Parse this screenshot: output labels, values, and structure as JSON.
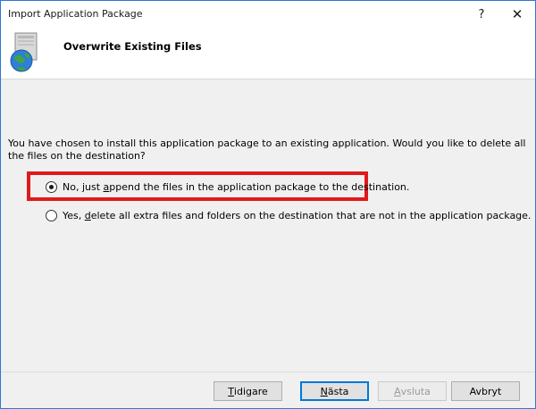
{
  "window": {
    "title": "Import Application Package",
    "help_glyph": "?",
    "close_glyph": "✕"
  },
  "header": {
    "title": "Overwrite Existing Files",
    "icon": "globe-package-icon"
  },
  "content": {
    "question": "You have chosen to install this application package to an existing application. Would you like to delete all the files on the destination?",
    "options": [
      {
        "pre": "No, just ",
        "accel": "a",
        "post": "ppend the files in the application package to the destination.",
        "checked": true
      },
      {
        "pre": "Yes, ",
        "accel": "d",
        "post": "elete all extra files and folders on the destination that are not in the application package.",
        "checked": false
      }
    ],
    "highlight_color": "#e01919"
  },
  "buttons": {
    "back": {
      "accel": "T",
      "rest": "idigare"
    },
    "next": {
      "accel": "N",
      "rest": "ästa"
    },
    "finish": {
      "accel": "A",
      "rest": "vsluta",
      "enabled": false
    },
    "cancel": {
      "label": "Avbryt"
    }
  }
}
